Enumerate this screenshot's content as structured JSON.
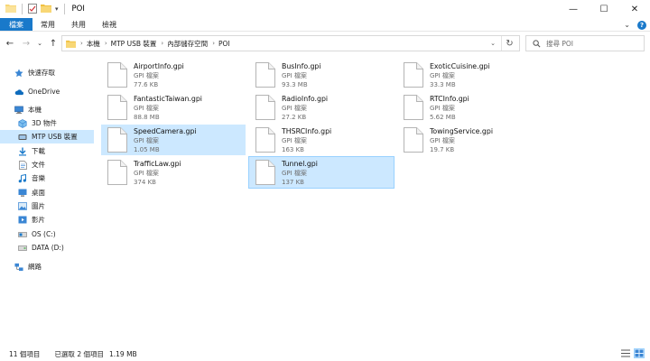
{
  "window": {
    "title": "POI",
    "minimize_glyph": "—",
    "maximize_glyph": "☐",
    "close_glyph": "✕"
  },
  "ribbon": {
    "tabs": [
      "檔案",
      "常用",
      "共用",
      "檢視"
    ],
    "collapse_glyph": "⌄",
    "help_glyph": "?"
  },
  "nav_buttons": {
    "back": "←",
    "forward": "→",
    "recent": "⌄",
    "up": "↑"
  },
  "address": {
    "crumbs": [
      "本機",
      "MTP USB 裝置",
      "內部儲存空間",
      "POI"
    ],
    "separator": "›",
    "dropdown_glyph": "⌄",
    "refresh_glyph": "↻"
  },
  "search": {
    "placeholder": "搜尋 POI"
  },
  "sidebar": {
    "items": [
      {
        "label": "快速存取",
        "icon": "star-icon"
      },
      {
        "label": "OneDrive",
        "icon": "cloud-icon"
      },
      {
        "label": "本機",
        "icon": "computer-icon"
      },
      {
        "label": "3D 物件",
        "icon": "cube-icon"
      },
      {
        "label": "MTP USB 裝置",
        "icon": "device-icon",
        "selected": true
      },
      {
        "label": "下載",
        "icon": "download-icon"
      },
      {
        "label": "文件",
        "icon": "document-icon"
      },
      {
        "label": "音樂",
        "icon": "music-icon"
      },
      {
        "label": "桌面",
        "icon": "desktop-icon"
      },
      {
        "label": "圖片",
        "icon": "pictures-icon"
      },
      {
        "label": "影片",
        "icon": "video-icon"
      },
      {
        "label": "OS (C:)",
        "icon": "drive-icon"
      },
      {
        "label": "DATA (D:)",
        "icon": "drive-icon"
      },
      {
        "label": "網路",
        "icon": "network-icon"
      }
    ]
  },
  "files": [
    {
      "name": "AirportInfo.gpi",
      "type": "GPI 檔案",
      "size": "77.6 KB",
      "selected": false
    },
    {
      "name": "BusInfo.gpi",
      "type": "GPI 檔案",
      "size": "93.3 MB",
      "selected": false
    },
    {
      "name": "ExoticCuisine.gpi",
      "type": "GPI 檔案",
      "size": "33.3 MB",
      "selected": false
    },
    {
      "name": "FantasticTaiwan.gpi",
      "type": "GPI 檔案",
      "size": "88.8 MB",
      "selected": false
    },
    {
      "name": "RadioInfo.gpi",
      "type": "GPI 檔案",
      "size": "27.2 KB",
      "selected": false
    },
    {
      "name": "RTCInfo.gpi",
      "type": "GPI 檔案",
      "size": "5.62 MB",
      "selected": false
    },
    {
      "name": "SpeedCamera.gpi",
      "type": "GPI 檔案",
      "size": "1.05 MB",
      "selected": true
    },
    {
      "name": "THSRCInfo.gpi",
      "type": "GPI 檔案",
      "size": "163 KB",
      "selected": false
    },
    {
      "name": "TowingService.gpi",
      "type": "GPI 檔案",
      "size": "19.7 KB",
      "selected": false
    },
    {
      "name": "TrafficLaw.gpi",
      "type": "GPI 檔案",
      "size": "374 KB",
      "selected": false
    },
    {
      "name": "Tunnel.gpi",
      "type": "GPI 檔案",
      "size": "137 KB",
      "selected": true,
      "focused": true
    }
  ],
  "status": {
    "item_count": "11 個項目",
    "selected_count": "已選取 2 個項目",
    "selected_size": "1.19 MB"
  },
  "colors": {
    "accent": "#1979ca",
    "selection": "#cce8ff",
    "selection_border": "#99d1ff",
    "folder": "#f8d775"
  }
}
